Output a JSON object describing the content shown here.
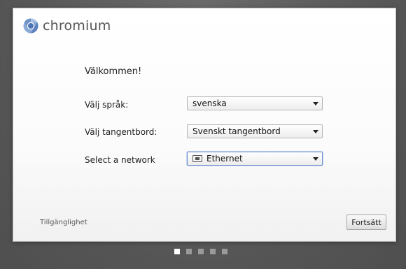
{
  "brand": {
    "name": "chromium"
  },
  "welcome": "Välkommen!",
  "form": {
    "language": {
      "label": "Välj språk:",
      "value": "svenska"
    },
    "keyboard": {
      "label": "Välj tangentbord:",
      "value": "Svenskt tangentbord"
    },
    "network": {
      "label": "Select a network",
      "value": "Ethernet",
      "icon": "ethernet-icon"
    }
  },
  "footer": {
    "accessibility": "Tillgänglighet",
    "continue": "Fortsätt"
  },
  "steps": {
    "total": 5,
    "current": 1
  }
}
